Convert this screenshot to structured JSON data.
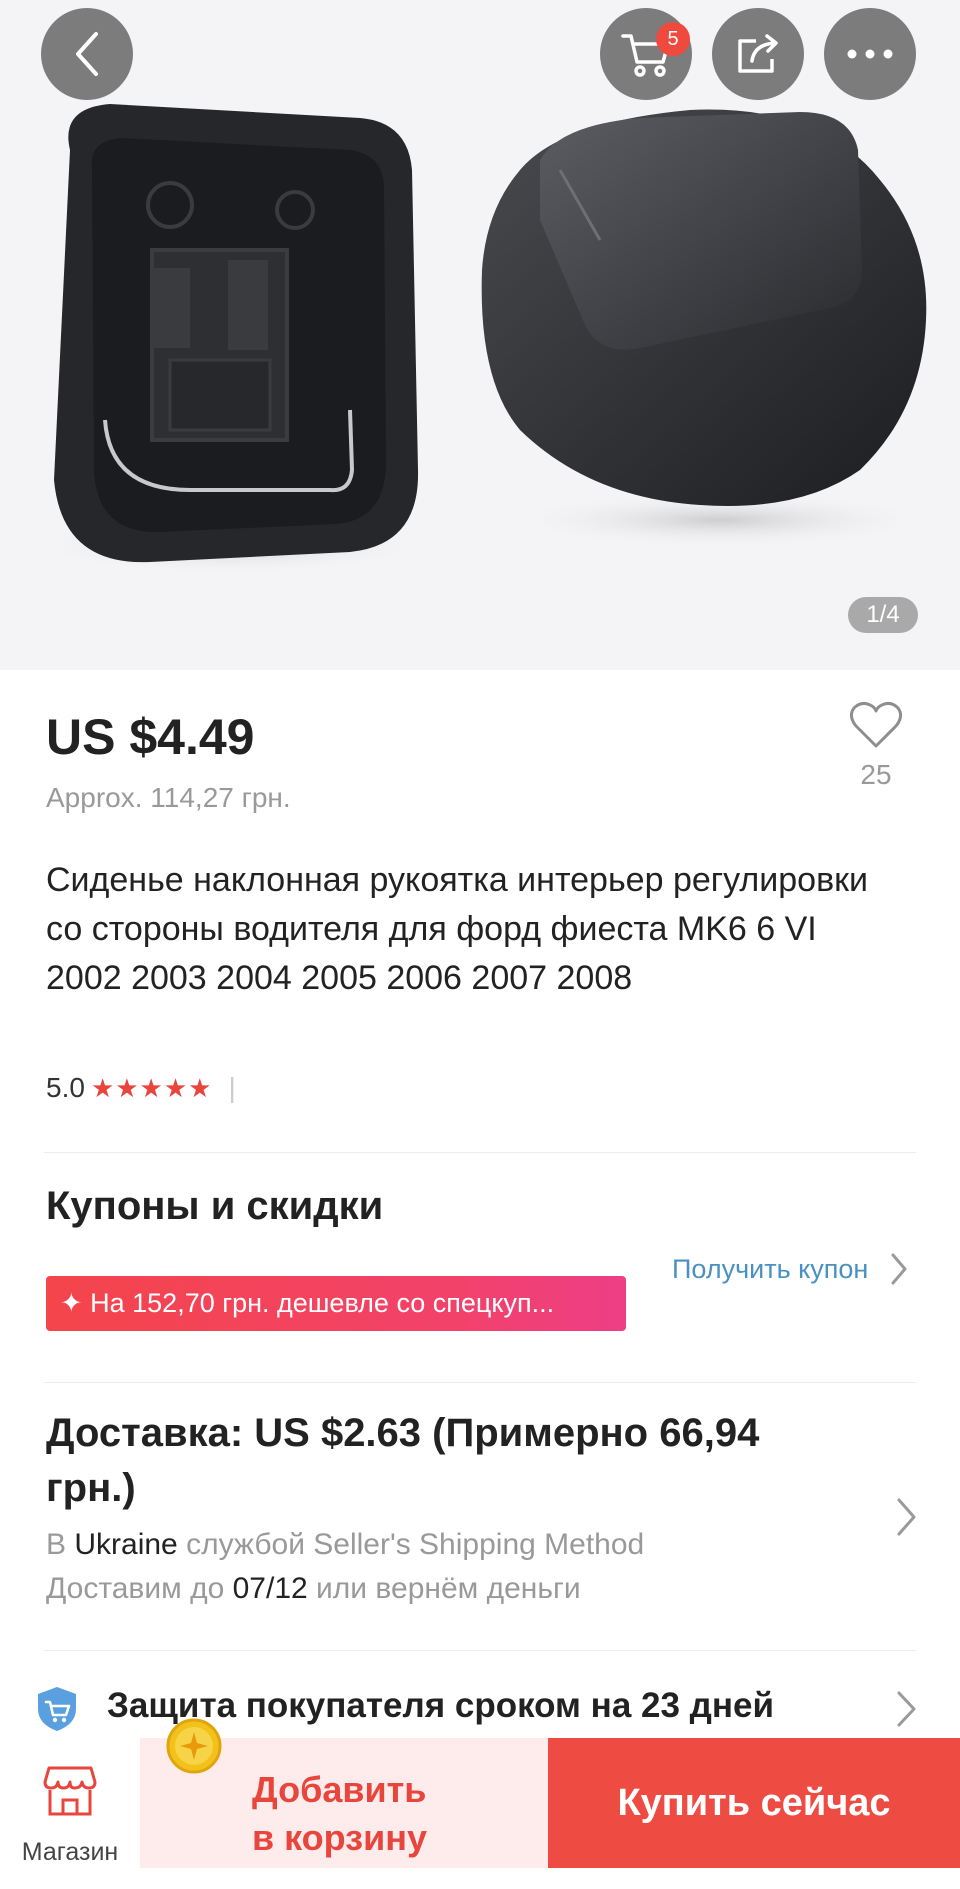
{
  "header": {
    "cart_badge": "5",
    "page_indicator": "1/4",
    "icons": [
      "back-arrow-icon",
      "cart-icon",
      "share-icon",
      "more-icon"
    ]
  },
  "product": {
    "price": "US $4.49",
    "approx_price": "Approx. 114,27 грн.",
    "wishlist_count": "25",
    "title": "Сиденье наклонная рукоятка интерьер регулировки со стороны водителя для форд фиеста MK6 6 VI 2002 2003 2004 2005 2006 2007 2008",
    "rating": "5.0",
    "rating_stars": 5,
    "rating_stars_text": "★★★★★",
    "rating_separator": "|"
  },
  "coupons": {
    "title": "Купоны и скидки",
    "get_coupon_label": "Получить купон",
    "banner_text": "✦ На 152,70 грн. дешевле со спецкуп..."
  },
  "shipping": {
    "title": "Доставка: US $2.63 (Примерно 66,94 грн.)",
    "line1_prefix": "В",
    "line1_country": "Ukraine",
    "line1_suffix": "службой Seller's Shipping Method",
    "line2_prefix": "Доставим до",
    "line2_date": "07/12",
    "line2_suffix": "или вернём деньги"
  },
  "protection": {
    "text": "Защита покупателя сроком на 23 дней"
  },
  "bottom_bar": {
    "store_label": "Магазин",
    "add_to_cart_line1": "Добавить",
    "add_to_cart_line2": "в корзину",
    "buy_now_label": "Купить сейчас"
  },
  "colors": {
    "accent_red": "#ee4b43",
    "coupon_gradient_start": "#f4454b",
    "coupon_gradient_end": "#ee3e86",
    "link_blue": "#4a90c2",
    "muted_gray": "#999999"
  }
}
